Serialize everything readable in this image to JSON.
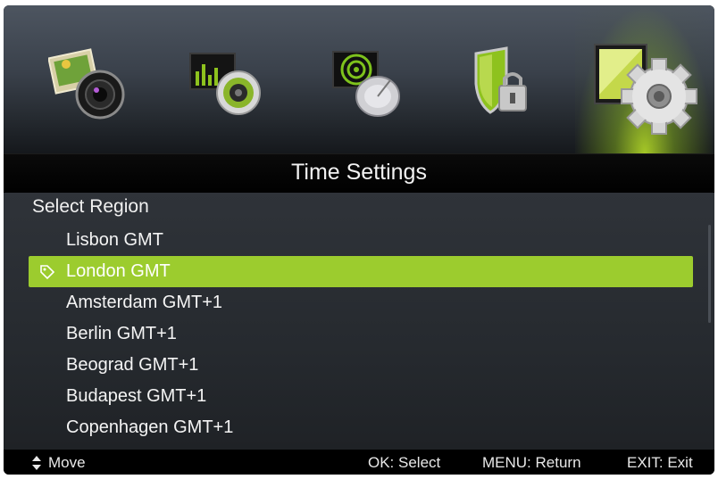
{
  "menu_tabs": [
    {
      "icon": "picture-icon",
      "active": false
    },
    {
      "icon": "sound-icon",
      "active": false
    },
    {
      "icon": "channel-icon",
      "active": false
    },
    {
      "icon": "lock-icon",
      "active": false
    },
    {
      "icon": "setup-gear-icon",
      "active": true
    }
  ],
  "title": "Time Settings",
  "section_label": "Select Region",
  "regions": [
    {
      "label": "Lisbon GMT",
      "selected": false
    },
    {
      "label": "London GMT",
      "selected": true
    },
    {
      "label": "Amsterdam GMT+1",
      "selected": false
    },
    {
      "label": "Berlin GMT+1",
      "selected": false
    },
    {
      "label": "Beograd GMT+1",
      "selected": false
    },
    {
      "label": "Budapest GMT+1",
      "selected": false
    },
    {
      "label": "Copenhagen GMT+1",
      "selected": false
    }
  ],
  "footer": {
    "move": "Move",
    "ok": "OK: Select",
    "menu": "MENU: Return",
    "exit": "EXIT: Exit"
  },
  "colors": {
    "highlight": "#9ccc2e",
    "background": "#2b2f34"
  }
}
